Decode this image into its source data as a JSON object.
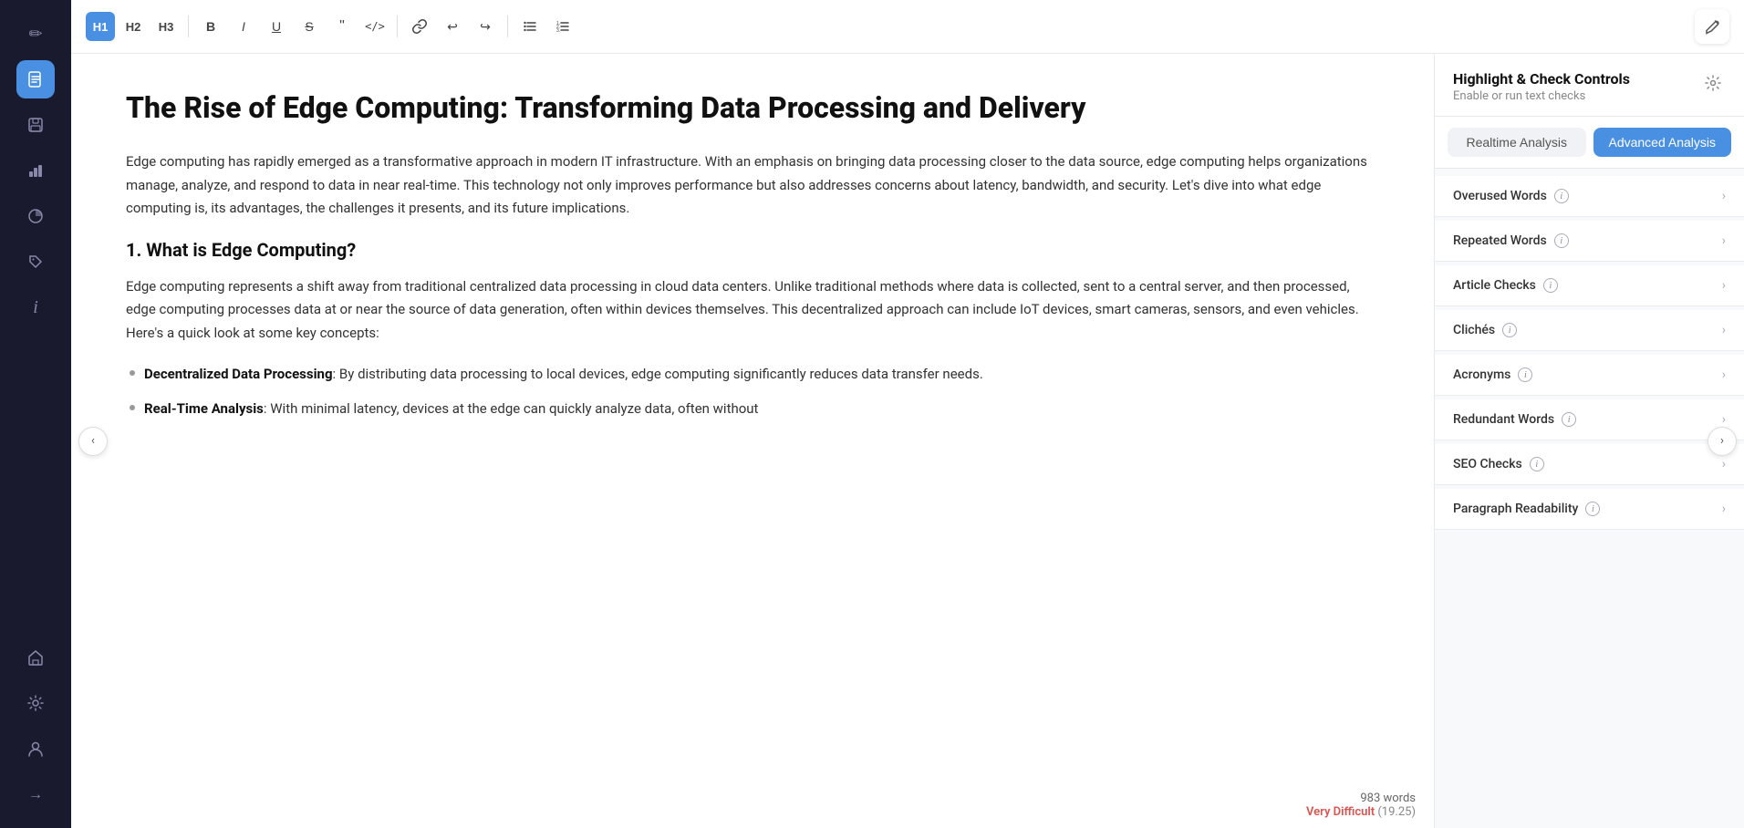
{
  "sidebar": {
    "icons": [
      {
        "name": "pencil-icon",
        "symbol": "✏",
        "active": false
      },
      {
        "name": "doc-check-icon",
        "symbol": "📋",
        "active": true
      },
      {
        "name": "save-icon",
        "symbol": "💾",
        "active": false
      },
      {
        "name": "chart-bar-icon",
        "symbol": "📊",
        "active": false
      },
      {
        "name": "chart-pie-icon",
        "symbol": "🥧",
        "active": false
      },
      {
        "name": "tag-icon",
        "symbol": "🏷",
        "active": false
      },
      {
        "name": "info-icon",
        "symbol": "ⓘ",
        "active": false
      },
      {
        "name": "home-icon",
        "symbol": "⌂",
        "active": false
      },
      {
        "name": "settings-icon",
        "symbol": "⚙",
        "active": false
      },
      {
        "name": "user-icon",
        "symbol": "👤",
        "active": false
      },
      {
        "name": "arrow-right-icon",
        "symbol": "→",
        "active": false
      }
    ]
  },
  "toolbar": {
    "heading_buttons": [
      {
        "label": "H1",
        "active": true
      },
      {
        "label": "H2",
        "active": false
      },
      {
        "label": "H3",
        "active": false
      }
    ],
    "format_buttons": [
      {
        "label": "B",
        "symbol": "B",
        "title": "Bold"
      },
      {
        "label": "I",
        "symbol": "I",
        "title": "Italic"
      },
      {
        "label": "U",
        "symbol": "U",
        "title": "Underline"
      },
      {
        "label": "S",
        "symbol": "S",
        "title": "Strikethrough"
      },
      {
        "label": "quote",
        "symbol": "❝",
        "title": "Blockquote"
      },
      {
        "label": "code",
        "symbol": "<>",
        "title": "Code"
      }
    ],
    "insert_buttons": [
      {
        "label": "link",
        "symbol": "🔗",
        "title": "Link"
      },
      {
        "label": "undo",
        "symbol": "↩",
        "title": "Undo"
      },
      {
        "label": "redo",
        "symbol": "↪",
        "title": "Redo"
      }
    ],
    "list_buttons": [
      {
        "label": "ul",
        "symbol": "☰",
        "title": "Unordered List"
      },
      {
        "label": "ol",
        "symbol": "≡",
        "title": "Ordered List"
      }
    ],
    "edit_button_symbol": "✏"
  },
  "editor": {
    "title": "The Rise of Edge Computing: Transforming Data Processing and Delivery",
    "paragraphs": [
      "Edge computing has rapidly emerged as a transformative approach in modern IT infrastructure. With an emphasis on bringing data processing closer to the data source, edge computing helps organizations manage, analyze, and respond to data in near real-time. This technology not only improves performance but also addresses concerns about latency, bandwidth, and security. Let's dive into what edge computing is, its advantages, the challenges it presents, and its future implications.",
      "1. What is Edge Computing?",
      "Edge computing represents a shift away from traditional centralized data processing in cloud data centers. Unlike traditional methods where data is collected, sent to a central server, and then processed, edge computing processes data at or near the source of data generation, often within devices themselves. This decentralized approach can include IoT devices, smart cameras, sensors, and even vehicles. Here's a quick look at some key concepts:"
    ],
    "bullet_items": [
      {
        "bold_text": "Decentralized Data Processing",
        "rest_text": ": By distributing data processing to local devices, edge computing significantly reduces data transfer needs."
      },
      {
        "bold_text": "Real-Time Analysis",
        "rest_text": ": With minimal latency, devices at the edge can quickly analyze data, often without"
      }
    ],
    "word_count": "983 words",
    "difficulty_label": "Very Difficult",
    "difficulty_score": "(19.25)"
  },
  "right_panel": {
    "title": "Highlight & Check Controls",
    "subtitle": "Enable or run text checks",
    "gear_symbol": "⚙",
    "tabs": [
      {
        "label": "Realtime Analysis",
        "active": false
      },
      {
        "label": "Advanced Analysis",
        "active": true
      }
    ],
    "check_items": [
      {
        "label": "Overused Words",
        "has_info": true
      },
      {
        "label": "Repeated Words",
        "has_info": true
      },
      {
        "label": "Article Checks",
        "has_info": true
      },
      {
        "label": "Clichés",
        "has_info": true
      },
      {
        "label": "Acronyms",
        "has_info": true
      },
      {
        "label": "Redundant Words",
        "has_info": true
      },
      {
        "label": "SEO Checks",
        "has_info": true
      },
      {
        "label": "Paragraph Readability",
        "has_info": true
      }
    ],
    "info_symbol": "i",
    "chevron_symbol": "›"
  }
}
